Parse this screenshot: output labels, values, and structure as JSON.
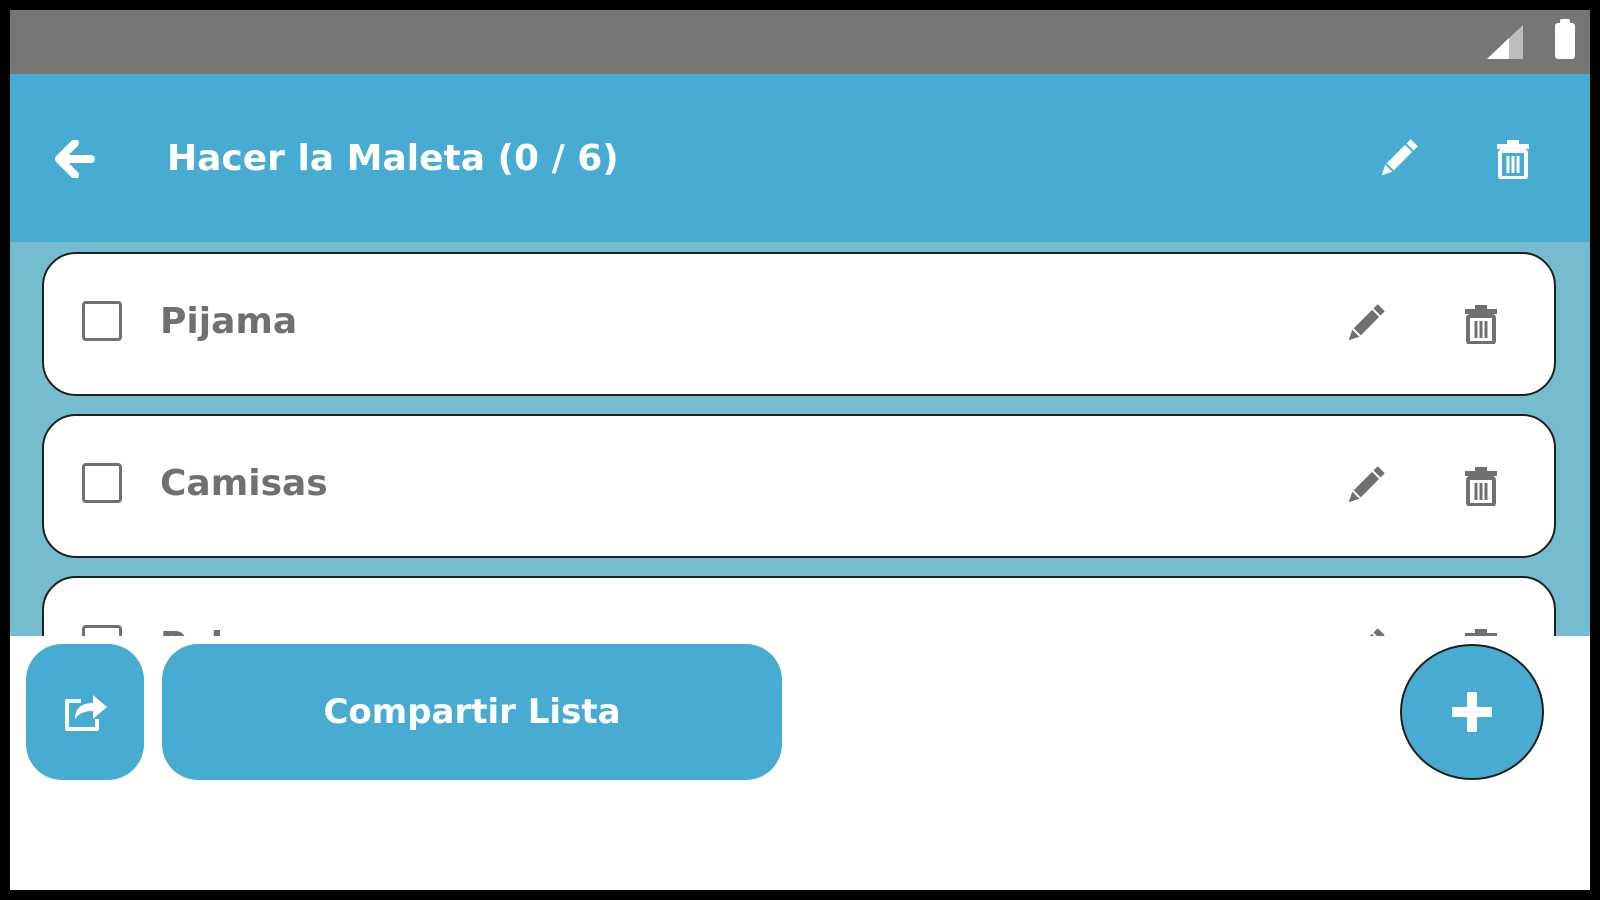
{
  "colors": {
    "primary": "#48abd1",
    "list_background": "#74bcce",
    "status_bar": "#767676",
    "item_text": "#707070",
    "white": "#ffffff"
  },
  "status_bar": {
    "icons": [
      "signal-icon",
      "battery-icon"
    ]
  },
  "header": {
    "title": "Hacer la Maleta (0 / 6)",
    "back_icon": "arrow-left-icon",
    "edit_icon": "pencil-icon",
    "delete_icon": "trash-icon"
  },
  "items": [
    {
      "label": "Pijama",
      "checked": false
    },
    {
      "label": "Camisas",
      "checked": false
    },
    {
      "label": "Pelo...",
      "checked": false
    }
  ],
  "footer": {
    "share_icon": "share-icon",
    "share_label": "Compartir Lista",
    "add_icon": "plus-icon"
  }
}
